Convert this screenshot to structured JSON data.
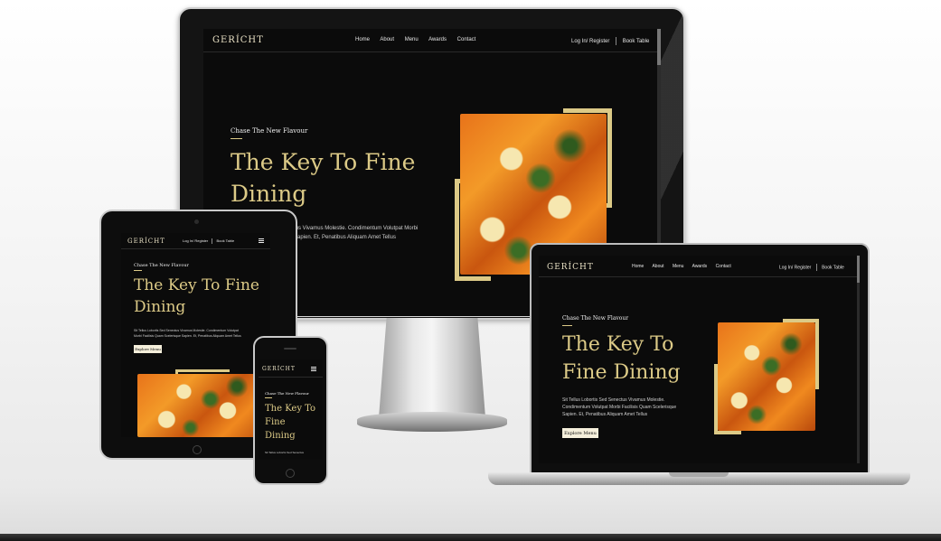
{
  "site": {
    "brand": "GERÍCHT",
    "nav": [
      "Home",
      "About",
      "Menu",
      "Awards",
      "Contact"
    ],
    "login": "Log In/ Register",
    "book": "Book Table",
    "hero": {
      "subtitle": "Chase The New Flavour",
      "title_line1": "The Key To Fine",
      "title_line2": "Dining",
      "laptop_title_line1": "The Key To",
      "laptop_title_line2": "Fine Dining",
      "phone_title_line1": "The Key To",
      "phone_title_line2": "Fine",
      "phone_title_line3": "Dining",
      "text": "Sit Tellus Lobortis Sed Senectus Vivamus Molestie. Condimentum Volutpat Morbi Facilisis Quam Scelerisque Sapien. Et, Penatibus Aliquam Amet Tellus",
      "desktop_text_line1": "tus Vivamus Molestie. Condimentum Volutpat Morbi",
      "desktop_text_line2": "Sapien. Et, Penatibus Aliquam Amet Tellus",
      "laptop_text_line1": "Sit Tellus Lobortis Sed Senectus Vivamus Molestie.",
      "laptop_text_line2": "Condimentum Volutpat Morbi Facilisis Quam Scelerisque",
      "laptop_text_line3": "Sapien. Et, Penatibus Aliquam Amet Tellus",
      "tablet_text_line1": "Sit Tellus Lobortis Sed Senectus Vivamus Molestie. Condimentum Volutpat",
      "tablet_text_line2": "Morbi Facilisis Quam Scelerisque Sapien. Et, Penatibus Aliquam Amet Tellus",
      "phone_text": "Sit Tellus Lobortis Sed Senectus",
      "cta": "Explore Menu"
    },
    "menu_icon": "hamburger-icon"
  },
  "colors": {
    "gold": "#dcca87",
    "background": "#0b0b0b",
    "button": "#f5efdb"
  }
}
